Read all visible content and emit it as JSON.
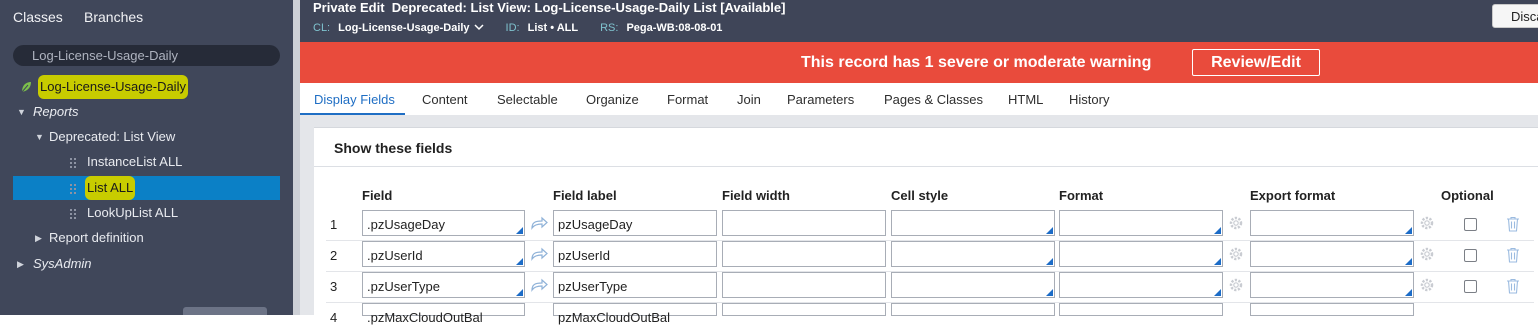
{
  "left_panel": {
    "tabs": [
      "Classes",
      "Branches"
    ],
    "search_value": "Log-License-Usage-Daily",
    "tree": {
      "class_name": "Log-License-Usage-Daily",
      "reports": "Reports",
      "deprecated": "Deprecated: List View",
      "instance_list": "InstanceList ALL",
      "list_all": "List ALL",
      "lookup_list": "LookUpList ALL",
      "report_definition": "Report definition",
      "sysadmin": "SysAdmin"
    }
  },
  "header": {
    "title": "Private Edit  Deprecated: List View: Log-License-Usage-Daily List [Available]",
    "cl_label": "CL:",
    "cl_value": "Log-License-Usage-Daily",
    "id_label": "ID:",
    "id_value": "List • ALL",
    "rs_label": "RS:",
    "rs_value": "Pega-WB:08-08-01",
    "discard_label": "Disca"
  },
  "banner": {
    "message": "This record has 1 severe or moderate warning",
    "button": "Review/Edit",
    "color": "#e94b3c"
  },
  "tabs": [
    "Display Fields",
    "Content",
    "Selectable",
    "Organize",
    "Format",
    "Join",
    "Parameters",
    "Pages & Classes",
    "HTML",
    "History"
  ],
  "active_tab": "Display Fields",
  "panel": {
    "title": "Show these fields",
    "columns": [
      "Field",
      "Field label",
      "Field width",
      "Cell style",
      "Format",
      "Export format",
      "Optional"
    ],
    "rows": [
      {
        "num": "1",
        "field": ".pzUsageDay",
        "label": "pzUsageDay"
      },
      {
        "num": "2",
        "field": ".pzUserId",
        "label": "pzUserId"
      },
      {
        "num": "3",
        "field": ".pzUserType",
        "label": "pzUserType"
      },
      {
        "num": "4",
        "field": ".pzMaxCloudOutBal",
        "label": "pzMaxCloudOutBal"
      }
    ]
  },
  "colors": {
    "accent": "#1f6ec4",
    "nav_bg": "#40475a",
    "selected": "#0b80c6",
    "highlight": "#c8cc00"
  }
}
